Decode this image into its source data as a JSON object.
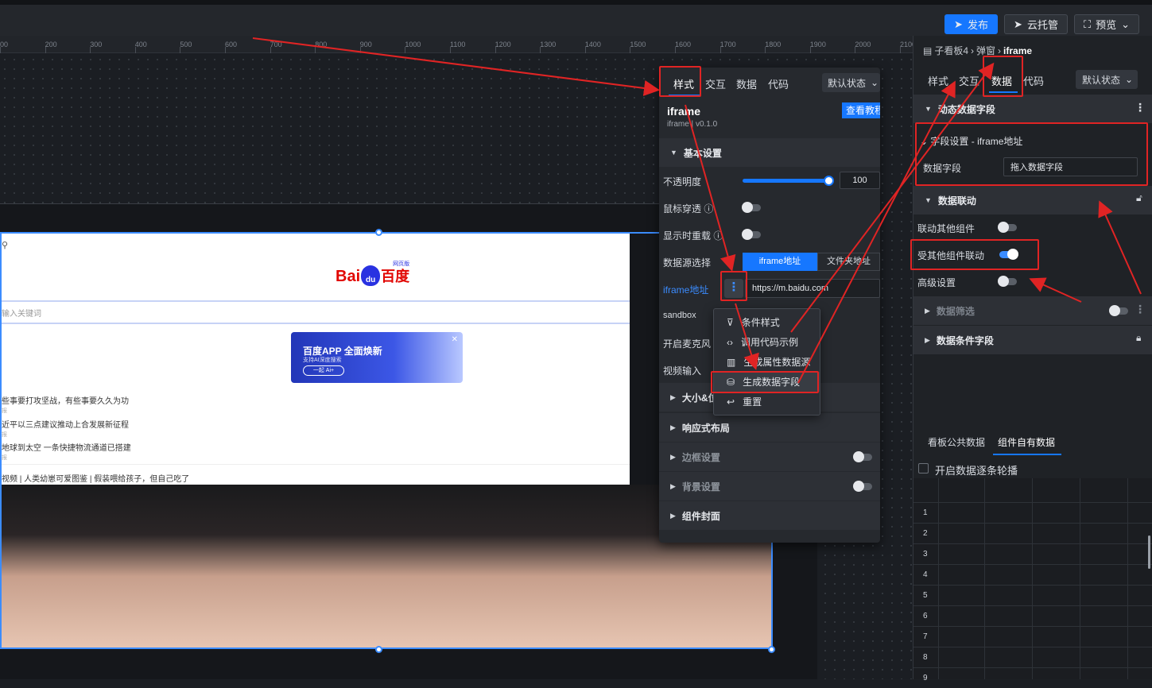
{
  "topbar": {
    "publish": "发布",
    "cloud": "云托管",
    "preview": "预览"
  },
  "ruler": {
    "ticks": [
      "00",
      "200",
      "300",
      "400",
      "500",
      "600",
      "700",
      "800",
      "900",
      "1000",
      "1100",
      "1200",
      "1300",
      "1400",
      "1500",
      "1600",
      "1700",
      "1800",
      "1900",
      "2000",
      "2100"
    ]
  },
  "webpage": {
    "logo_left": "Bai",
    "logo_du": "du",
    "logo_right": "百度",
    "logo_tag": "网页版",
    "search_placeholder": "输入关键词",
    "banner_title": "百度APP 全面焕新",
    "banner_sub": "支持AI深度搜索",
    "banner_btn": "一起 Ai+",
    "news": [
      {
        "title": "些事要打攻坚战，有些事要久久为功",
        "source": "报"
      },
      {
        "title": "近平以三点建议推动上合发展新征程",
        "source": "报"
      },
      {
        "title": "地球到太空 一条快捷物流通道已搭建",
        "source": "报"
      }
    ],
    "video_line": "视频 | 人类幼崽可爱图鉴 | 假装喂给孩子，但自己吃了"
  },
  "float_panel": {
    "tabs": [
      "样式",
      "交互",
      "数据",
      "代码"
    ],
    "state_select": "默认状态",
    "component_name": "iframe",
    "component_version": "iframe | v0.1.0",
    "tutorial_btn": "查看教程",
    "basic_section": "基本设置",
    "opacity_label": "不透明度",
    "opacity_value": "100",
    "mouse_through_label": "鼠标穿透",
    "reload_label": "显示时重载",
    "source_label": "数据源选择",
    "source_options": [
      "iframe地址",
      "文件夹地址"
    ],
    "iframe_url_label": "iframe地址",
    "iframe_url_value": "https://m.baidu.com",
    "sandbox_label": "sandbox",
    "mic_label": "开启麦克风",
    "video_label": "视频输入",
    "size_section": "大小&位",
    "responsive_section": "响应式布局",
    "border_section": "边框设置",
    "bg_section": "背景设置",
    "cover_section": "组件封面"
  },
  "context_menu": {
    "items": [
      "条件样式",
      "调用代码示例",
      "生成属性数据源",
      "生成数据字段",
      "重置"
    ]
  },
  "right_panel": {
    "breadcrumb": [
      "子看板4",
      "弹窗",
      "iframe"
    ],
    "tabs": [
      "样式",
      "交互",
      "数据",
      "代码"
    ],
    "state_select": "默认状态",
    "dynamic_fields": "动态数据字段",
    "field_setting": "字段设置 - iframe地址",
    "data_field_label": "数据字段",
    "data_field_input": "拖入数据字段",
    "linkage_section": "数据联动",
    "link_other": "联动其他组件",
    "linked_by_other": "受其他组件联动",
    "advanced": "高级设置",
    "filter_section": "数据筛选",
    "condition_section": "数据条件字段",
    "bottom_tabs": [
      "看板公共数据",
      "组件自有数据"
    ],
    "carousel_label": "开启数据逐条轮播",
    "row_numbers": [
      "1",
      "2",
      "3",
      "4",
      "5",
      "6",
      "7",
      "8",
      "9"
    ]
  },
  "colors": {
    "accent": "#1677ff",
    "highlight": "#e02424"
  }
}
